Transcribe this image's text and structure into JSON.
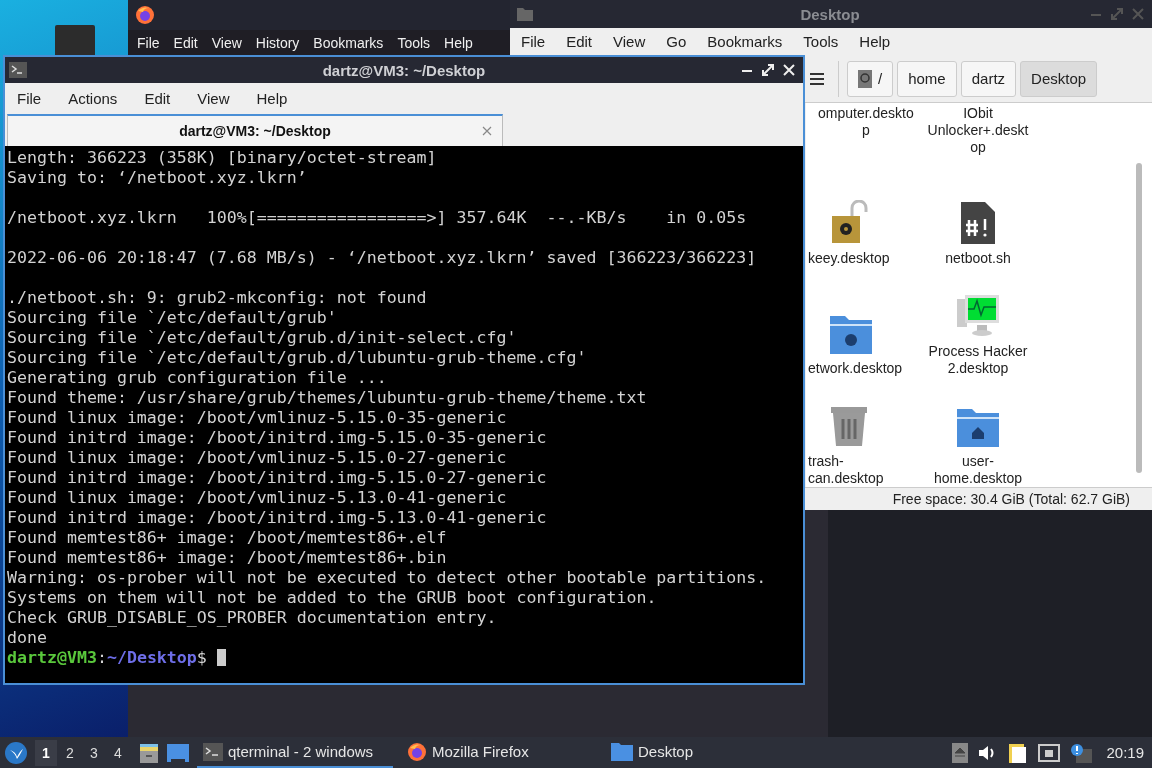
{
  "firefox": {
    "menu": [
      "File",
      "Edit",
      "View",
      "History",
      "Bookmarks",
      "Tools",
      "Help"
    ]
  },
  "file_manager": {
    "title": "Desktop",
    "menu": [
      "File",
      "Edit",
      "View",
      "Go",
      "Bookmarks",
      "Tools",
      "Help"
    ],
    "path": [
      {
        "label": "/",
        "selected": false
      },
      {
        "label": "home",
        "selected": false
      },
      {
        "label": "dartz",
        "selected": false
      },
      {
        "label": "Desktop",
        "selected": true
      }
    ],
    "items": [
      {
        "kind": "hidden",
        "lines": [
          "omputer.deskto",
          "p"
        ]
      },
      {
        "kind": "hidden",
        "lines": [
          "IObit",
          "Unlocker+.deskt",
          "op"
        ]
      },
      {
        "kind": "lock",
        "lines": [
          "keey.desktop"
        ]
      },
      {
        "kind": "script",
        "lines": [
          "netboot.sh"
        ]
      },
      {
        "kind": "network-folder",
        "lines": [
          "etwork.desktop"
        ]
      },
      {
        "kind": "monitor",
        "lines": [
          "Process Hacker",
          "2.desktop"
        ]
      },
      {
        "kind": "trash",
        "lines": [
          "trash-",
          "can.desktop"
        ]
      },
      {
        "kind": "home-folder",
        "lines": [
          "user-",
          "home.desktop"
        ]
      }
    ],
    "status": "Free space: 30.4 GiB (Total: 62.7 GiB)"
  },
  "terminal": {
    "title": "dartz@VM3: ~/Desktop",
    "menu": [
      "File",
      "Actions",
      "Edit",
      "View",
      "Help"
    ],
    "tabs": [
      {
        "label": "dartz@VM3: ~/Desktop",
        "selected": true
      }
    ],
    "blocks": [
      [
        "Length: 366223 (358K) [binary/octet-stream]",
        "Saving to: ‘/netboot.xyz.lkrn’"
      ],
      [
        "/netboot.xyz.lkrn   100%[=================>] 357.64K  --.-KB/s    in 0.05s"
      ],
      [
        "2022-06-06 20:18:47 (7.68 MB/s) - ‘/netboot.xyz.lkrn’ saved [366223/366223]"
      ],
      [
        "./netboot.sh: 9: grub2-mkconfig: not found",
        "Sourcing file `/etc/default/grub'",
        "Sourcing file `/etc/default/grub.d/init-select.cfg'",
        "Sourcing file `/etc/default/grub.d/lubuntu-grub-theme.cfg'",
        "Generating grub configuration file ...",
        "Found theme: /usr/share/grub/themes/lubuntu-grub-theme/theme.txt",
        "Found linux image: /boot/vmlinuz-5.15.0-35-generic",
        "Found initrd image: /boot/initrd.img-5.15.0-35-generic",
        "Found linux image: /boot/vmlinuz-5.15.0-27-generic",
        "Found initrd image: /boot/initrd.img-5.15.0-27-generic",
        "Found linux image: /boot/vmlinuz-5.13.0-41-generic",
        "Found initrd image: /boot/initrd.img-5.13.0-41-generic",
        "Found memtest86+ image: /boot/memtest86+.elf",
        "Found memtest86+ image: /boot/memtest86+.bin",
        "Warning: os-prober will not be executed to detect other bootable partitions.",
        "Systems on them will not be added to the GRUB boot configuration.",
        "Check GRUB_DISABLE_OS_PROBER documentation entry.",
        "done"
      ]
    ],
    "prompt": {
      "user_host": "dartz@VM3",
      "separator": ":",
      "path": "~/Desktop",
      "symbol": "$"
    }
  },
  "taskbar": {
    "workspaces": [
      {
        "label": "1",
        "selected": true
      },
      {
        "label": "2",
        "selected": false
      },
      {
        "label": "3",
        "selected": false
      },
      {
        "label": "4",
        "selected": false
      }
    ],
    "tasks": [
      {
        "kind": "terminal",
        "label": "qterminal - 2 windows",
        "selected": true
      },
      {
        "kind": "firefox",
        "label": "Mozilla Firefox",
        "selected": false
      },
      {
        "kind": "folder",
        "label": "Desktop",
        "selected": false
      }
    ],
    "clock": "20:19"
  }
}
